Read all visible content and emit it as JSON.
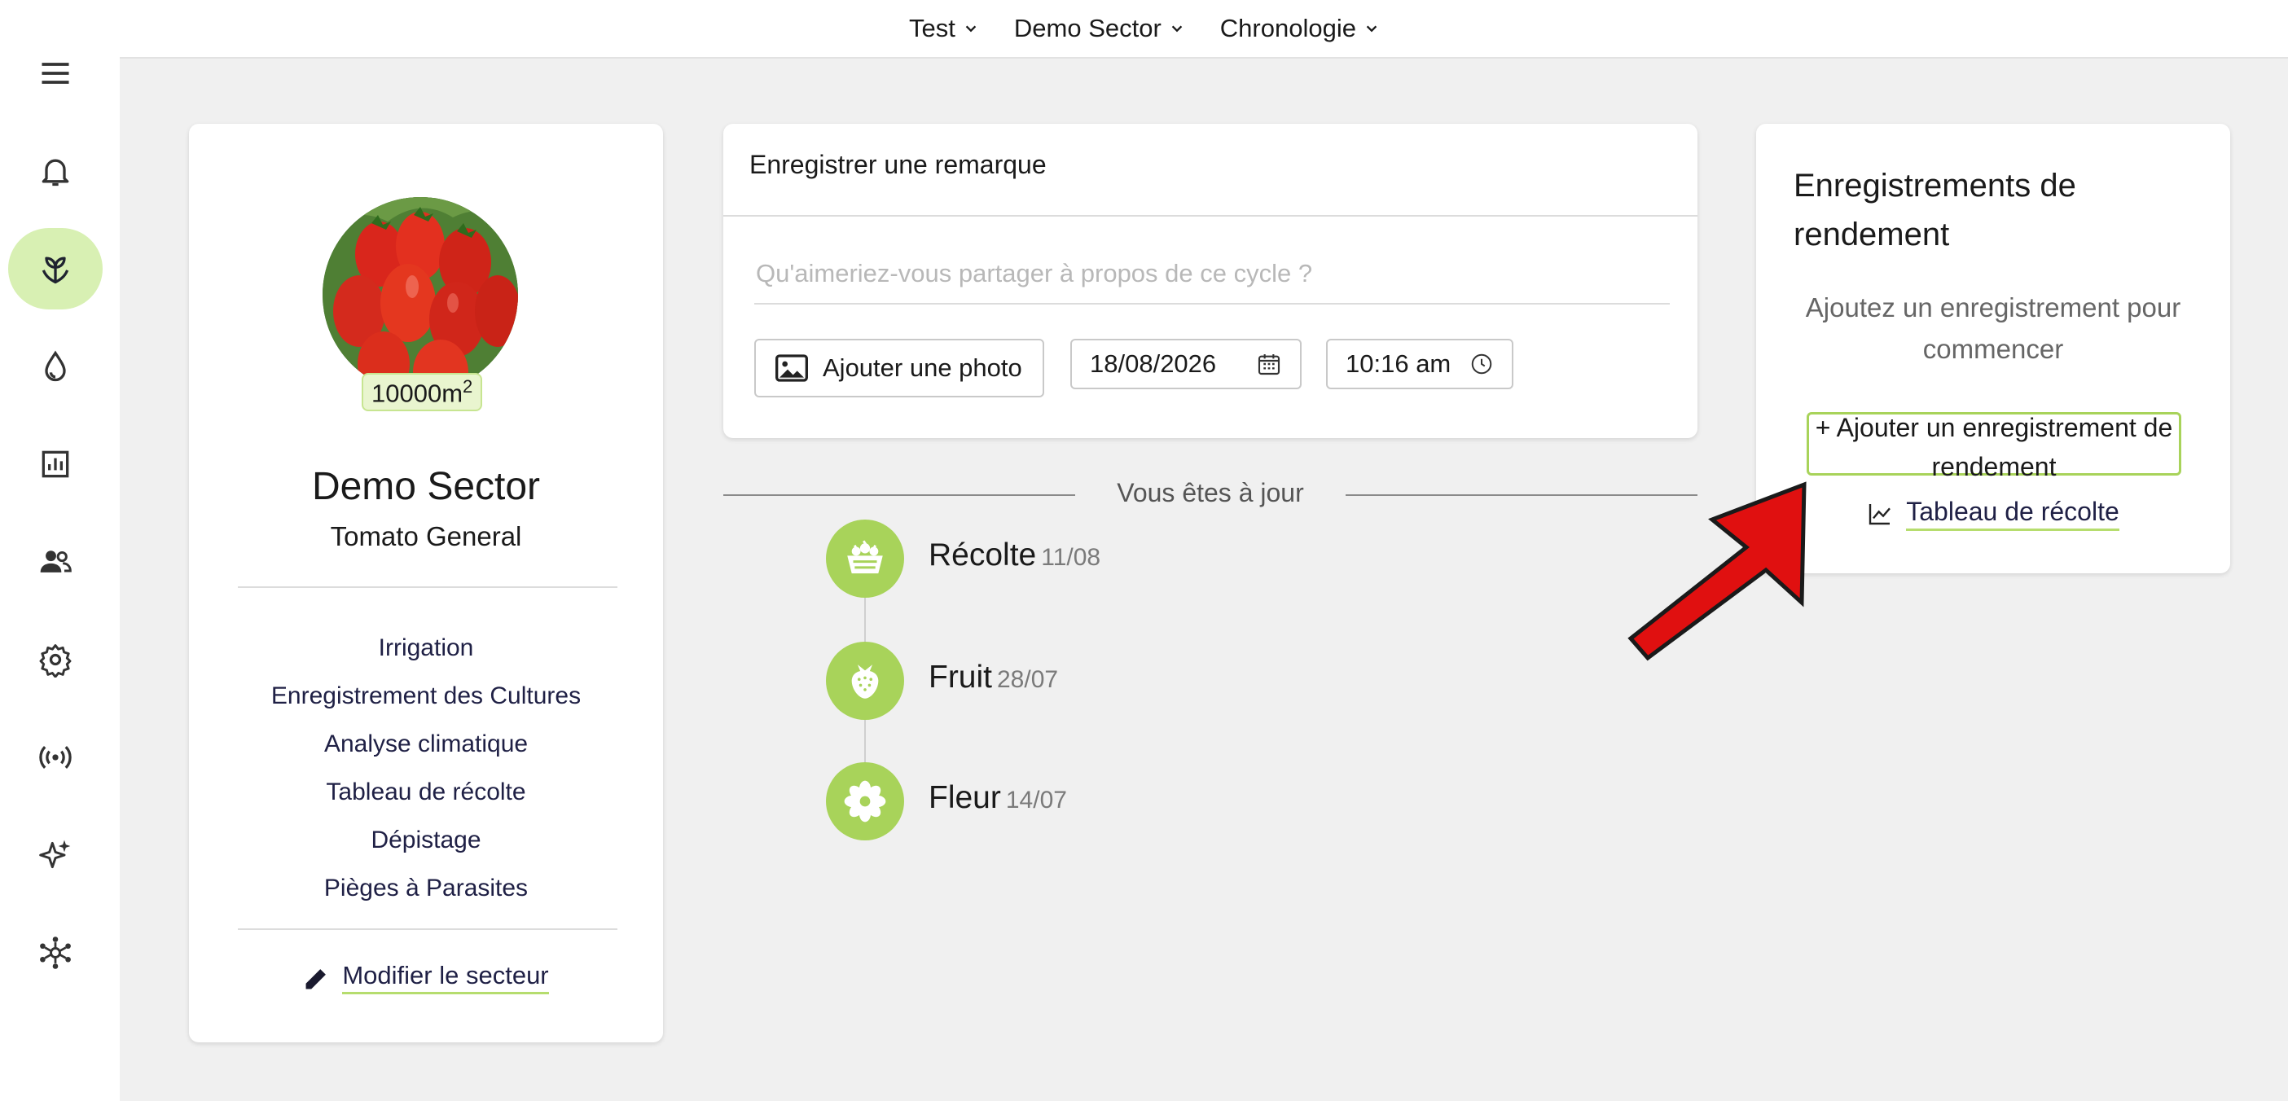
{
  "topbar": {
    "menus": [
      {
        "label": "Test"
      },
      {
        "label": "Demo Sector"
      },
      {
        "label": "Chronologie"
      }
    ]
  },
  "sidebar": {
    "items": [
      {
        "icon": "menu-icon"
      },
      {
        "icon": "bell-icon"
      },
      {
        "icon": "sprout-icon",
        "active": true
      },
      {
        "icon": "water-drop-icon"
      },
      {
        "icon": "bar-chart-icon"
      },
      {
        "icon": "users-icon"
      },
      {
        "icon": "gear-icon"
      },
      {
        "icon": "broadcast-icon"
      },
      {
        "icon": "sparkles-icon"
      },
      {
        "icon": "network-icon"
      }
    ]
  },
  "sector_card": {
    "area": "10000m",
    "area_exponent": "2",
    "name": "Demo Sector",
    "crop": "Tomato General",
    "links": [
      "Irrigation",
      "Enregistrement des Cultures",
      "Analyse climatique",
      "Tableau de récolte",
      "Dépistage",
      "Pièges à Parasites"
    ],
    "edit_label": "Modifier le secteur"
  },
  "remark": {
    "title": "Enregistrer une remarque",
    "placeholder": "Qu'aimeriez-vous partager à propos de ce cycle ?",
    "photo_button": "Ajouter une photo",
    "date": "18/08/2026",
    "time": "10:16 am"
  },
  "timeline": {
    "status": "Vous êtes à jour",
    "events": [
      {
        "label": "Récolte",
        "date": "11/08",
        "icon": "harvest-basket-icon"
      },
      {
        "label": "Fruit",
        "date": "28/07",
        "icon": "strawberry-icon"
      },
      {
        "label": "Fleur",
        "date": "14/07",
        "icon": "flower-icon"
      }
    ]
  },
  "yield_card": {
    "title": "Enregistrements de rendement",
    "empty_text": "Ajoutez un enregistrement pour commencer",
    "add_button": "+ Ajouter un enregistrement de rendement",
    "chart_link": "Tableau de récolte"
  },
  "colors": {
    "accent": "#a8d35a",
    "accent_light": "#d8f0b3",
    "annotation_arrow": "#e01010"
  }
}
